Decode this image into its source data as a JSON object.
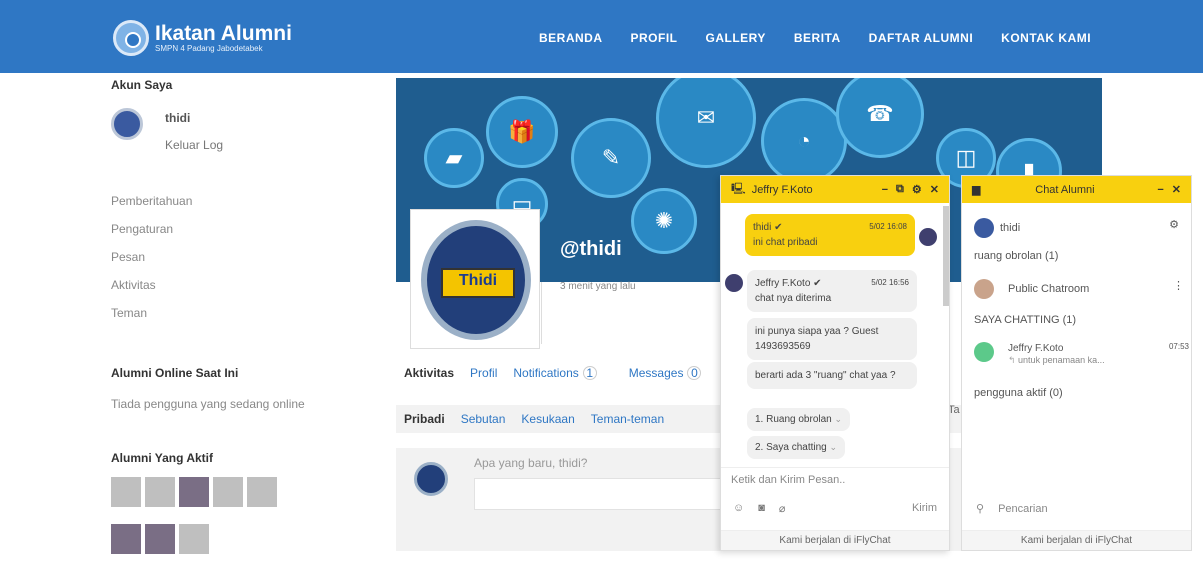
{
  "header": {
    "logo_title": "Ikatan Alumni",
    "logo_sub": "SMPN 4 Padang Jabodetabek",
    "nav": [
      "BERANDA",
      "PROFIL",
      "GALLERY",
      "BERITA",
      "DAFTAR ALUMNI",
      "KONTAK KAMI"
    ]
  },
  "sidebar": {
    "account_title": "Akun Saya",
    "username": "thidi",
    "logout": "Keluar Log",
    "menu": [
      "Pemberitahuan",
      "Pengaturan",
      "Pesan",
      "Aktivitas",
      "Teman"
    ],
    "online_title": "Alumni Online Saat Ini",
    "online_text": "Tiada pengguna yang sedang online",
    "active_title": "Alumni Yang Aktif"
  },
  "profile": {
    "handle": "@thidi",
    "last_active": "3 menit yang lalu",
    "tabs": [
      "Aktivitas",
      "Profil",
      "Notifications",
      "Messages"
    ],
    "notif_count": "1",
    "msg_count": "0",
    "subtabs": [
      "Pribadi",
      "Sebutan",
      "Kesukaan",
      "Teman-teman"
    ],
    "truncated": "Ta",
    "post_placeholder": "Apa yang baru, thidi?"
  },
  "chat": {
    "title": "Jeffry F.Koto",
    "controls": [
      "−",
      "⧉",
      "⚙",
      "✕"
    ],
    "messages": [
      {
        "name": "thidi ✔",
        "time": "5/02 16:08",
        "text": "ini chat pribadi"
      },
      {
        "name": "Jeffry F.Koto ✔",
        "time": "5/02 16:56",
        "text": "chat nya diterima"
      },
      {
        "text": "ini punya siapa yaa ? Guest 1493693569"
      },
      {
        "text": "berarti ada 3 \"ruang\" chat yaa ?"
      },
      {
        "text": "1. Ruang obrolan"
      },
      {
        "text": "2. Saya chatting"
      }
    ],
    "input_placeholder": "Ketik dan Kirim Pesan..",
    "send": "Kirim",
    "footer": "Kami berjalan di iFlyChat"
  },
  "alumni_chat": {
    "title": "Chat Alumni",
    "user": "thidi",
    "room_header": "ruang obrolan (1)",
    "room": "Public Chatroom",
    "chatting_header": "SAYA CHATTING (1)",
    "chat_name": "Jeffry F.Koto",
    "chat_time": "07:53",
    "chat_preview": "untuk penamaan ka...",
    "active_header": "pengguna aktif (0)",
    "search": "Pencarian",
    "footer": "Kami berjalan di iFlyChat"
  },
  "colors": {
    "header": "#2f77c4",
    "chat": "#f8d00f"
  }
}
